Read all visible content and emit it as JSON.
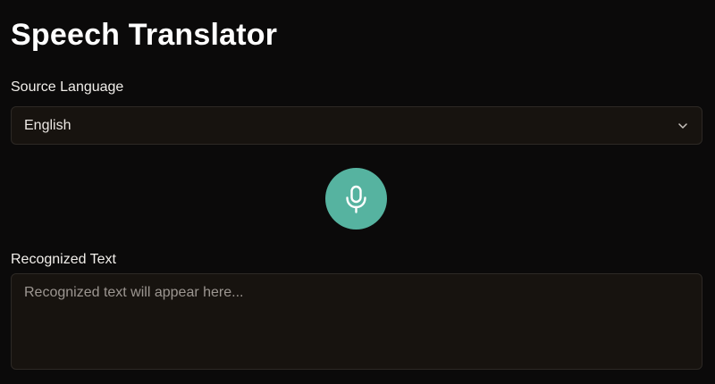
{
  "header": {
    "title": "Speech Translator"
  },
  "source_language": {
    "label": "Source Language",
    "selected": "English",
    "icon": "chevron-down-icon"
  },
  "mic": {
    "icon": "microphone-icon",
    "color": "#56b3a0"
  },
  "recognized": {
    "label": "Recognized Text",
    "value": "",
    "placeholder": "Recognized text will appear here..."
  },
  "colors": {
    "background": "#0b0a0a",
    "field_background": "#17130f",
    "field_border": "#2d2925",
    "accent": "#56b3a0"
  }
}
